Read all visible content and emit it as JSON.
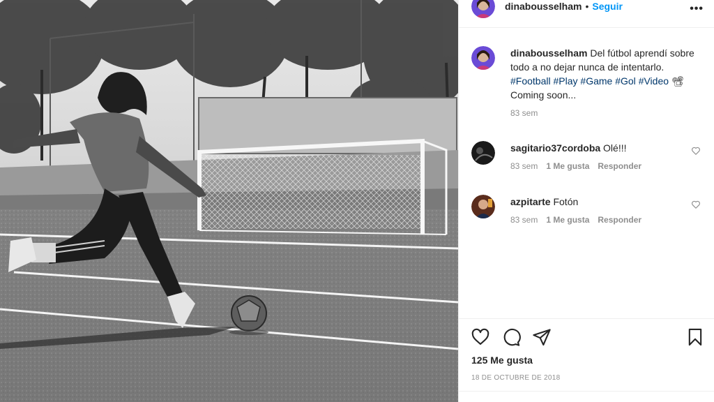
{
  "post": {
    "username": "dinabousselham",
    "separator": "•",
    "follow_label": "Seguir",
    "more_icon": "more-horizontal-icon",
    "caption": {
      "text_1": "Del fútbol aprendí sobre todo a no dejar nunca de intentarlo.",
      "tags_1": [
        "#Football",
        "#Play",
        "#Game",
        "#Gol",
        "#Video"
      ],
      "emoji": "📽",
      "text_2": "Coming soon...",
      "age": "83 sem"
    },
    "comments": [
      {
        "username": "sagitario37cordoba",
        "text": "Olé!!!",
        "age": "83 sem",
        "likes": "1 Me gusta",
        "reply": "Responder"
      },
      {
        "username": "azpitarte",
        "text": "Fotón",
        "age": "83 sem",
        "likes": "1 Me gusta",
        "reply": "Responder"
      }
    ],
    "actions": {
      "like_icon": "heart-icon",
      "comment_icon": "comment-icon",
      "share_icon": "send-icon",
      "save_icon": "bookmark-icon"
    },
    "likes_count": "125 Me gusta",
    "date": "18 DE OCTUBRE DE 2018"
  },
  "colors": {
    "link_blue": "#0095f6",
    "hashtag": "#00376b",
    "meta_gray": "#8e8e8e",
    "text": "#262626",
    "border": "#efefef"
  }
}
